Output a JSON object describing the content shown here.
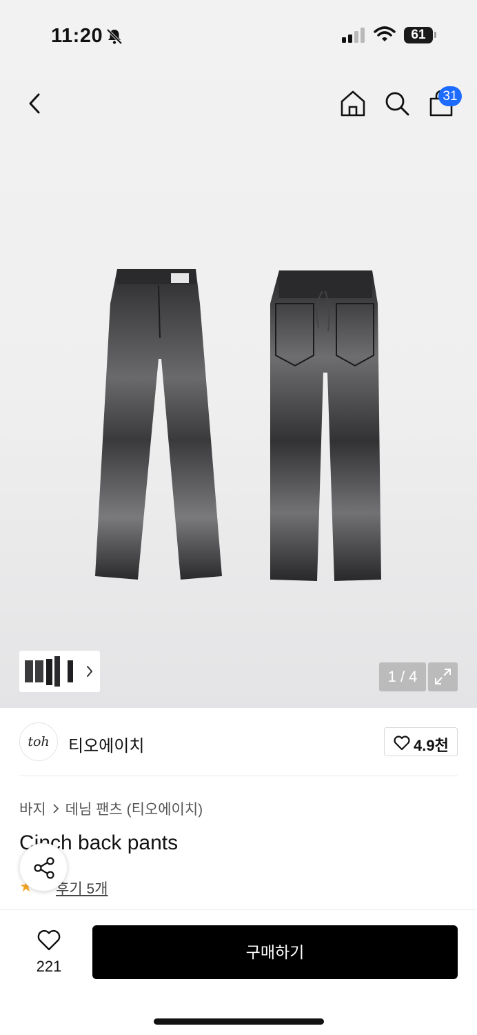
{
  "status_bar": {
    "time": "11:20",
    "battery": "61",
    "icons": [
      "bell-slash-icon",
      "cellular-signal-icon",
      "wifi-icon",
      "battery-icon"
    ]
  },
  "nav": {
    "icons": [
      "chevron-left-icon",
      "home-icon",
      "search-icon",
      "shopping-bag-icon"
    ],
    "cart_count": "31"
  },
  "gallery": {
    "page_counter": "1 / 4",
    "icons": [
      "chevron-right-icon",
      "expand-icon"
    ]
  },
  "brand": {
    "logo_text": "toh",
    "name": "티오에이치",
    "likes": "4.9천",
    "icon": "heart-outline-icon"
  },
  "product": {
    "breadcrumb": [
      "바지",
      "데님 팬츠 (티오에이치)"
    ],
    "title": "Cinch back pants",
    "rating_star_color": "#f5a623",
    "review_link": "후기 5개"
  },
  "bottom_bar": {
    "like_count": "221",
    "buy_label": "구매하기",
    "buy_color": "#000000",
    "icons": [
      "heart-outline-icon",
      "share-icon"
    ]
  }
}
